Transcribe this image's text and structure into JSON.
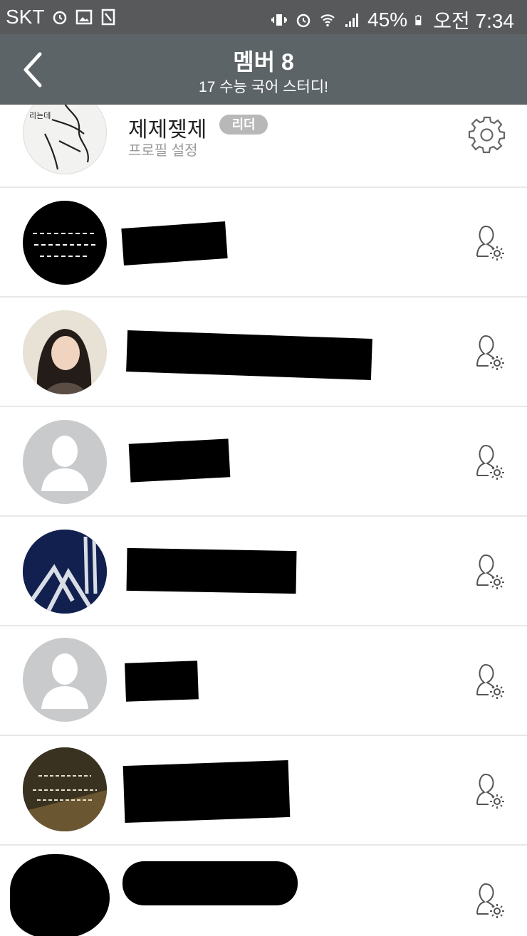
{
  "status_bar": {
    "carrier": "SKT",
    "battery": "45%",
    "time": "오전 7:34"
  },
  "header": {
    "title": "멤버 8",
    "subtitle": "17 수능 국어 스터디!"
  },
  "leader": {
    "name": "제제젲제",
    "badge": "리더",
    "subtext": "프로필 설정"
  },
  "colors": {
    "status_bar": "#57595a",
    "app_bar": "#5c6468",
    "badge": "#b8b8b8",
    "divider": "#e8e8e8"
  },
  "icons": {
    "back": "chevron-left-icon",
    "settings": "gear-icon",
    "member_settings": "user-gear-icon"
  }
}
